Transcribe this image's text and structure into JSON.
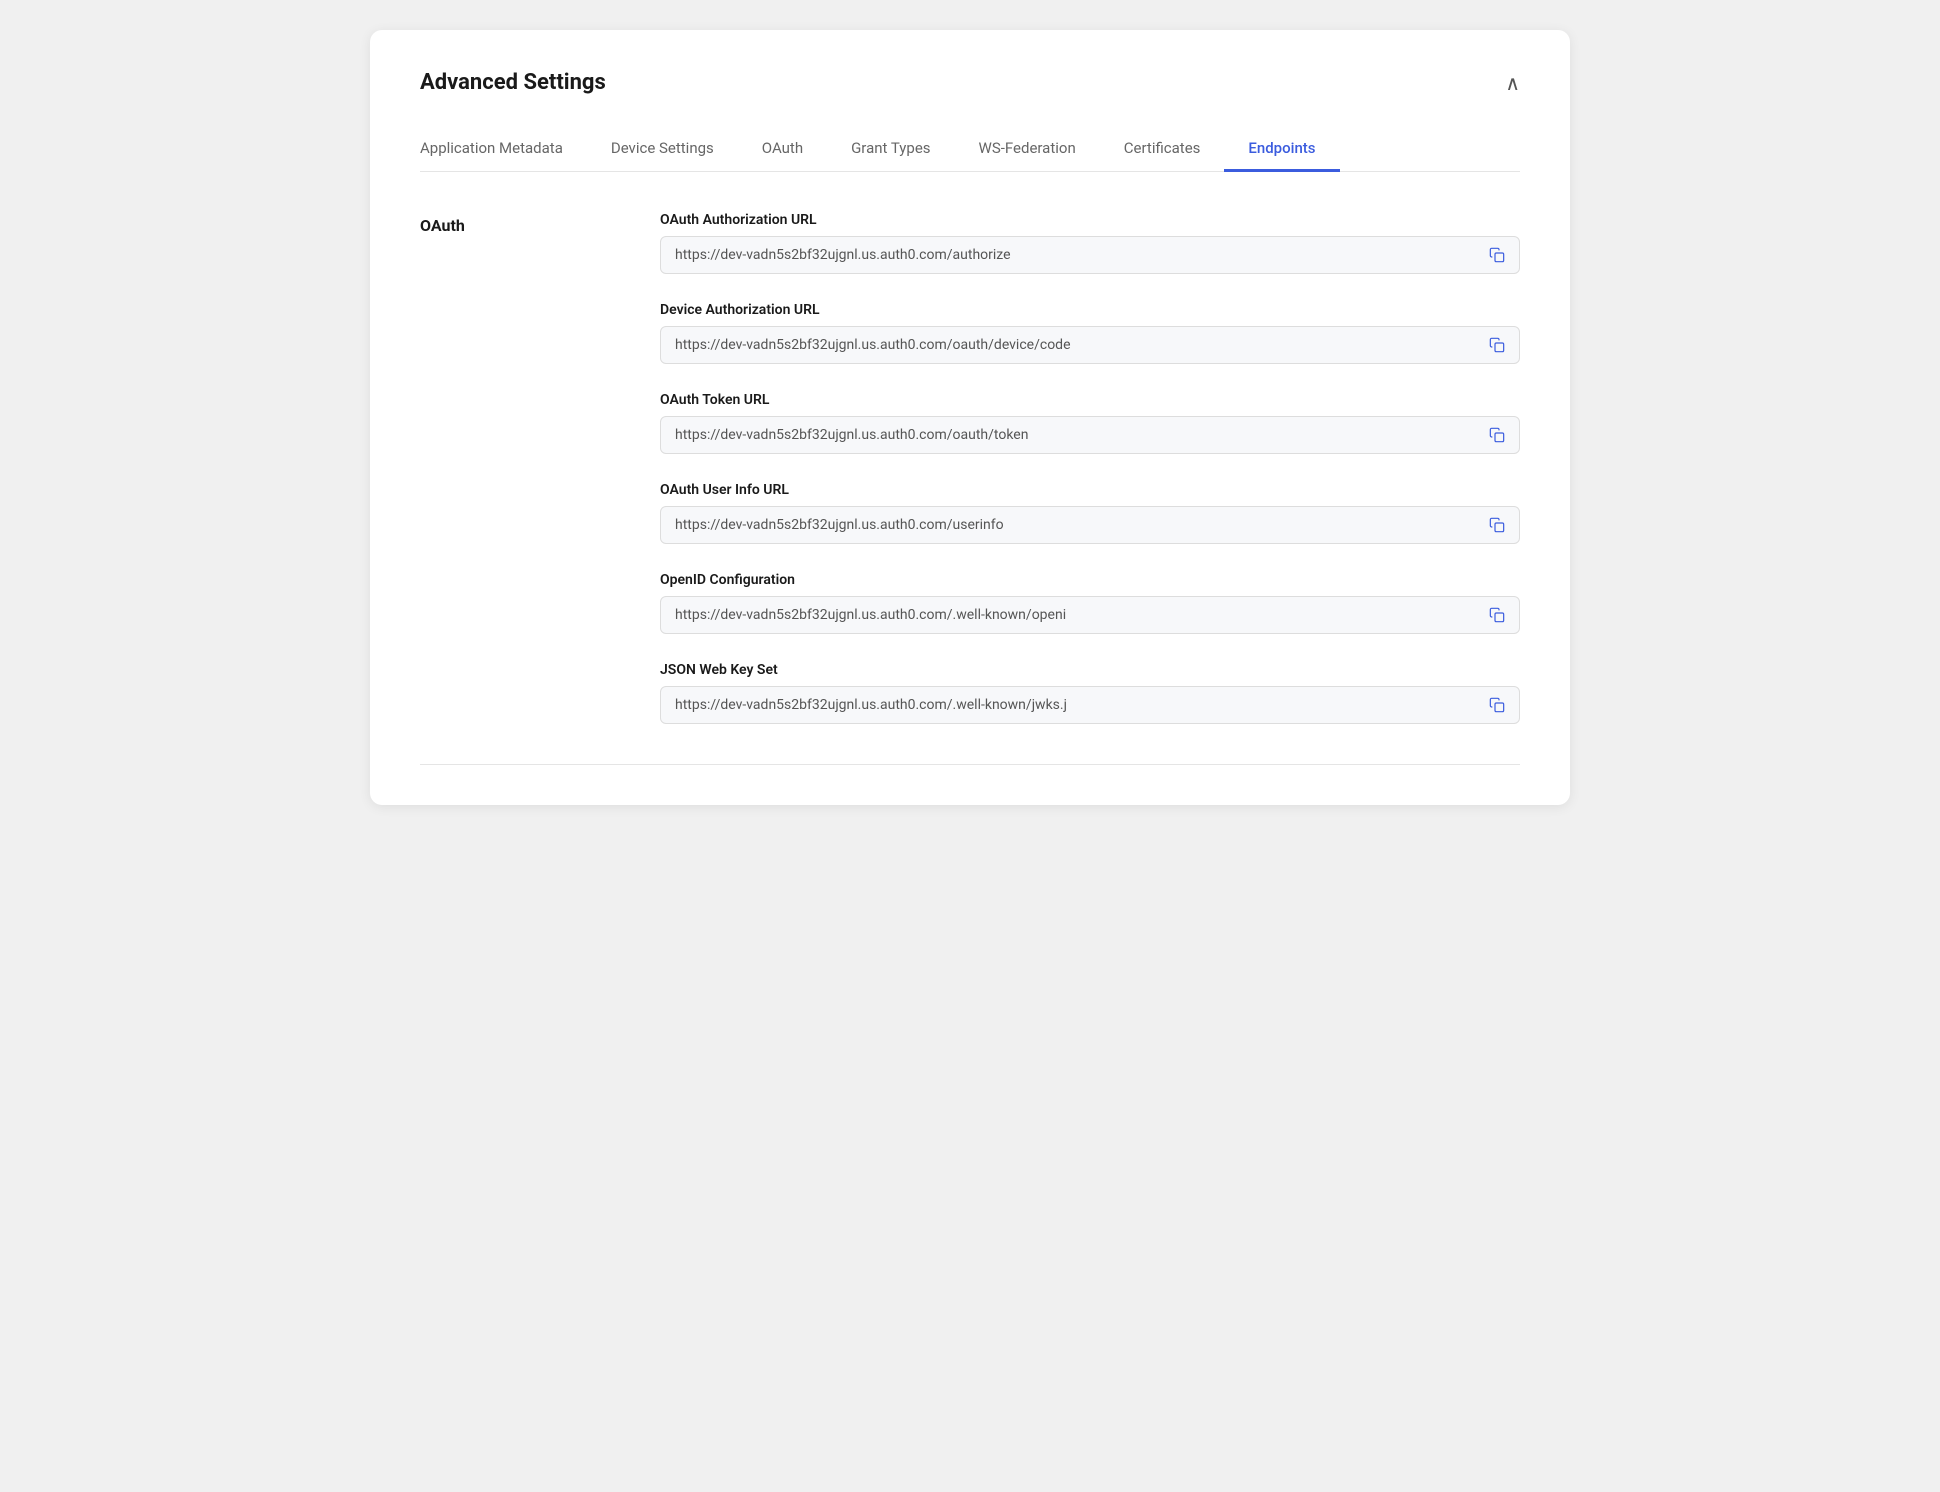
{
  "header": {
    "title": "Advanced Settings",
    "collapse_icon": "∧"
  },
  "tabs": [
    {
      "id": "application-metadata",
      "label": "Application Metadata",
      "active": false
    },
    {
      "id": "device-settings",
      "label": "Device Settings",
      "active": false
    },
    {
      "id": "oauth",
      "label": "OAuth",
      "active": false
    },
    {
      "id": "grant-types",
      "label": "Grant Types",
      "active": false
    },
    {
      "id": "ws-federation",
      "label": "WS-Federation",
      "active": false
    },
    {
      "id": "certificates",
      "label": "Certificates",
      "active": false
    },
    {
      "id": "endpoints",
      "label": "Endpoints",
      "active": true
    }
  ],
  "section": {
    "label": "OAuth"
  },
  "fields": [
    {
      "id": "oauth-authorization-url",
      "label": "OAuth Authorization URL",
      "value": "https://dev-vadn5s2bf32ujgnl.us.auth0.com/authorize"
    },
    {
      "id": "device-authorization-url",
      "label": "Device Authorization URL",
      "value": "https://dev-vadn5s2bf32ujgnl.us.auth0.com/oauth/device/code"
    },
    {
      "id": "oauth-token-url",
      "label": "OAuth Token URL",
      "value": "https://dev-vadn5s2bf32ujgnl.us.auth0.com/oauth/token"
    },
    {
      "id": "oauth-user-info-url",
      "label": "OAuth User Info URL",
      "value": "https://dev-vadn5s2bf32ujgnl.us.auth0.com/userinfo"
    },
    {
      "id": "openid-configuration",
      "label": "OpenID Configuration",
      "value": "https://dev-vadn5s2bf32ujgnl.us.auth0.com/.well-known/openi"
    },
    {
      "id": "json-web-key-set",
      "label": "JSON Web Key Set",
      "value": "https://dev-vadn5s2bf32ujgnl.us.auth0.com/.well-known/jwks.j"
    }
  ],
  "colors": {
    "active_tab": "#3b5cde",
    "copy_icon": "#3b5cde"
  }
}
